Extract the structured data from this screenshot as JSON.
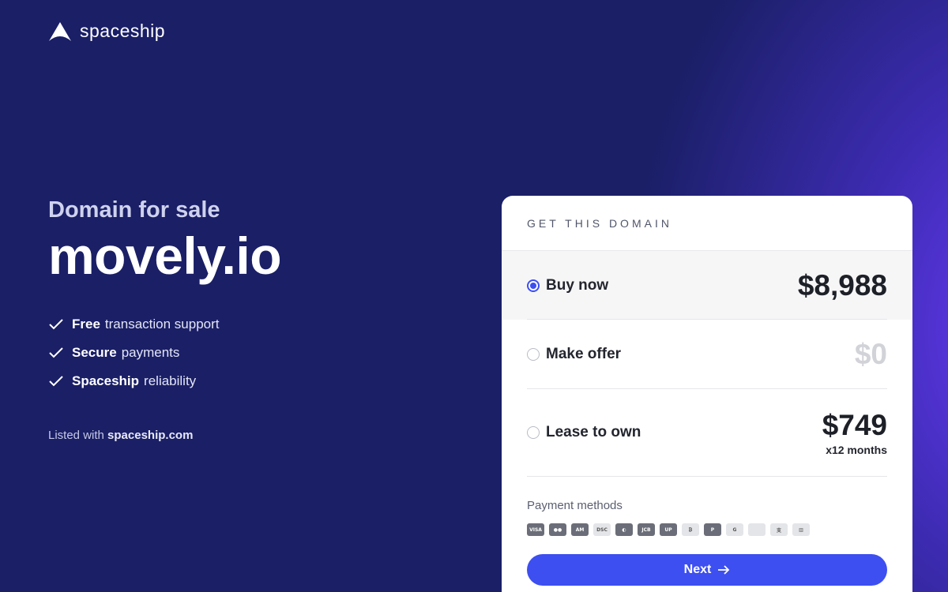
{
  "brand": {
    "name": "spaceship"
  },
  "hero": {
    "subtitle": "Domain for sale",
    "domain": "movely.io",
    "features": [
      {
        "bold": "Free",
        "text": "transaction support"
      },
      {
        "bold": "Secure",
        "text": "payments"
      },
      {
        "bold": "Spaceship",
        "text": "reliability"
      }
    ],
    "listed_prefix": "Listed with",
    "listed_site": "spaceship.com"
  },
  "card": {
    "header": "GET THIS DOMAIN",
    "options": [
      {
        "label": "Buy now",
        "price": "$8,988",
        "selected": true
      },
      {
        "label": "Make offer",
        "price": "$0",
        "selected": false
      },
      {
        "label": "Lease to own",
        "price": "$749",
        "sub": "x12 months",
        "selected": false
      }
    ],
    "payments_title": "Payment methods",
    "payment_icons": [
      "visa-icon",
      "mastercard-icon",
      "amex-icon",
      "discover-icon",
      "diners-icon",
      "jcb-icon",
      "unionpay-icon",
      "bitcoin-icon",
      "paypal-icon",
      "google-pay-icon",
      "apple-pay-icon",
      "alipay-icon",
      "bank-transfer-icon"
    ],
    "next_label": "Next"
  },
  "colors": {
    "accent": "#3d4ff0",
    "background": "#1a1f66",
    "glow": "#6e3cff"
  }
}
